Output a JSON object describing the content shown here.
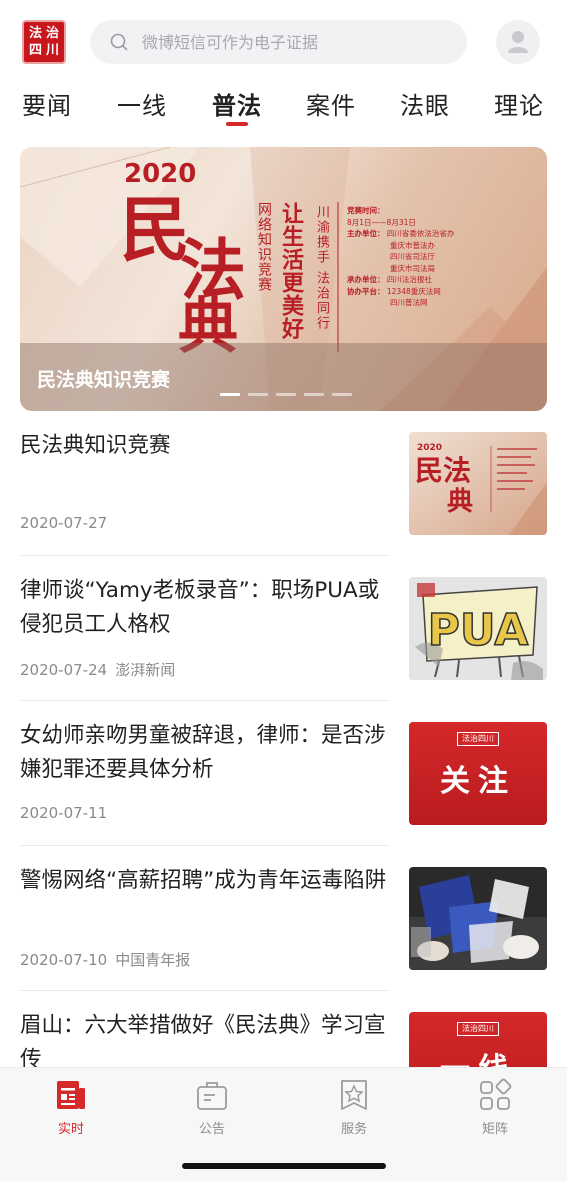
{
  "header": {
    "logo_chars": [
      "法",
      "治",
      "四",
      "川"
    ],
    "search_placeholder": "微博短信可作为电子证据"
  },
  "tabs": [
    {
      "label": "要闻",
      "active": false
    },
    {
      "label": "一线",
      "active": false
    },
    {
      "label": "普法",
      "active": true
    },
    {
      "label": "案件",
      "active": false
    },
    {
      "label": "法眼",
      "active": false
    },
    {
      "label": "理论",
      "active": false
    }
  ],
  "banner": {
    "year": "2020",
    "big_chars": [
      "民",
      "法",
      "典"
    ],
    "vertical_1": "网络知识竞赛",
    "vertical_2": "让生活更美好",
    "vertical_3": "川渝携手 法治同行",
    "info": {
      "time_label": "竞赛时间：",
      "time_value": "8月1日——8月31日",
      "host_label": "主办单位：",
      "host_values": [
        "四川省委依法治省办",
        "重庆市普法办",
        "四川省司法厅",
        "重庆市司法局"
      ],
      "organizer_label": "承办单位：",
      "organizer_value": "四川法治报社",
      "platform_label": "协办平台：",
      "platform_values": [
        "12348重庆法网",
        "四川普法网"
      ]
    },
    "caption": "民法典知识竞赛",
    "dot_count": 5,
    "active_dot": 0
  },
  "news": [
    {
      "title": "民法典知识竞赛",
      "date": "2020-07-27",
      "source": "",
      "thumb": "banner"
    },
    {
      "title": "律师谈“Yamy老板录音”：职场PUA或侵犯员工人格权",
      "date": "2020-07-24",
      "source": "澎湃新闻",
      "thumb": "pua",
      "thumb_text": "PUA"
    },
    {
      "title": "女幼师亲吻男童被辞退，律师：是否涉嫌犯罪还要具体分析",
      "date": "2020-07-11",
      "source": "",
      "thumb": "red",
      "thumb_text": "关注",
      "thumb_logo": "法治四川"
    },
    {
      "title": "警惕网络“高薪招聘”成为青年运毒陷阱",
      "date": "2020-07-10",
      "source": "中国青年报",
      "thumb": "photo"
    },
    {
      "title": "眉山：六大举措做好《民法典》学习宣传",
      "date": "",
      "source": "",
      "thumb": "red2",
      "thumb_text": "一线",
      "thumb_logo": "法治四川"
    }
  ],
  "bottom_nav": [
    {
      "label": "实时",
      "icon": "newspaper-icon",
      "active": true
    },
    {
      "label": "公告",
      "icon": "briefcase-icon",
      "active": false
    },
    {
      "label": "服务",
      "icon": "star-doc-icon",
      "active": false
    },
    {
      "label": "矩阵",
      "icon": "grid-icon",
      "active": false
    }
  ],
  "colors": {
    "accent": "#d42a2a",
    "banner_red": "#b81f25",
    "muted": "#8a8a8a"
  }
}
